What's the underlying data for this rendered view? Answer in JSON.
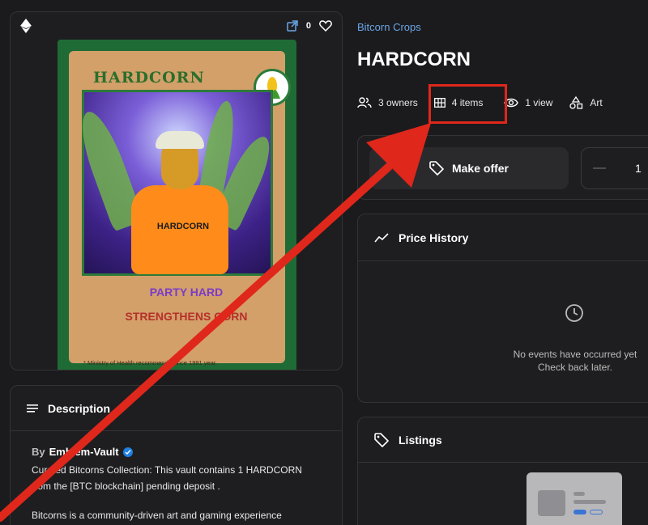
{
  "media": {
    "chain_icon": "ethereum-icon",
    "external_icon": "external-link-icon",
    "favorite_icon": "heart-icon",
    "like_count": "0"
  },
  "nft_image": {
    "title_text": "HARDCORN",
    "shirt_text": "HARDCORN",
    "line1": "PARTY HARD",
    "line2": "STRENGTHENS CORN",
    "footer": "* Ministry of Health recommends since 1991 year."
  },
  "description": {
    "header": "Description",
    "by_prefix": "By",
    "creator": "Emblem-Vault",
    "text1": "Curated Bitcorns Collection: This vault contains 1  HARDCORN from the [BTC blockchain] pending deposit .",
    "text2": "Bitcorns is a community-driven art and gaming experience"
  },
  "item": {
    "collection": "Bitcorn Crops",
    "title": "HARDCORN",
    "owners": "3 owners",
    "items": "4 items",
    "views": "1 view",
    "category": "Art"
  },
  "offer": {
    "button_label": "Make offer",
    "minus": "—",
    "quantity": "1"
  },
  "price_history": {
    "header": "Price History",
    "empty_line1": "No events have occurred yet",
    "empty_line2": "Check back later."
  },
  "listings": {
    "header": "Listings"
  },
  "colors": {
    "accent_link": "#6aa6e8",
    "highlight_red": "#e0271b",
    "background": "#1b1b1d"
  }
}
